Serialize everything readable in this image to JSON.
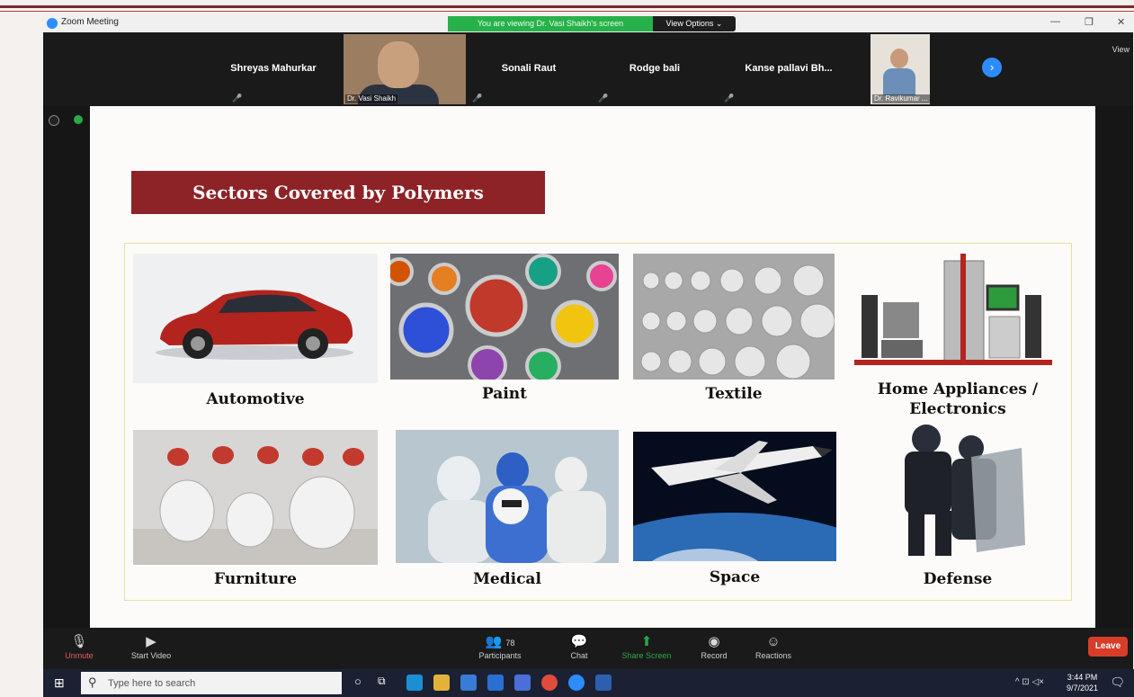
{
  "window": {
    "title": "Zoom Meeting"
  },
  "banner": {
    "viewing_text": "You are viewing Dr. Vasi Shaikh's screen",
    "view_options": "View Options ⌄"
  },
  "gallery": {
    "view_label": "View",
    "participants": [
      {
        "name": "Shreyas Mahurkar"
      },
      {
        "name": "Dr. Vasi Shaikh",
        "video": true
      },
      {
        "name": "Sonali Raut"
      },
      {
        "name": "Rodge bali"
      },
      {
        "name": "Kanse pallavi Bh..."
      },
      {
        "name": "Dr. Ravikumar ...",
        "video": true
      }
    ]
  },
  "slide": {
    "title": "Sectors Covered by Polymers",
    "sectors": [
      {
        "label": "Automotive",
        "icon": "car-image"
      },
      {
        "label": "Paint",
        "icon": "paint-cans-image"
      },
      {
        "label": "Textile",
        "icon": "fabric-rolls-image"
      },
      {
        "label": "Home Appliances / Electronics",
        "icon": "appliances-image"
      },
      {
        "label": "Furniture",
        "icon": "chairs-image"
      },
      {
        "label": "Medical",
        "icon": "medical-staff-image"
      },
      {
        "label": "Space",
        "icon": "space-shuttle-image"
      },
      {
        "label": "Defense",
        "icon": "riot-police-image"
      }
    ]
  },
  "toolbar": {
    "unmute": "Unmute",
    "start_video": "Start Video",
    "participants": "Participants",
    "participants_count": "78",
    "chat": "Chat",
    "share_screen": "Share Screen",
    "record": "Record",
    "reactions": "Reactions",
    "leave": "Leave"
  },
  "taskbar": {
    "search_placeholder": "Type here to search",
    "time": "3:44 PM",
    "date": "9/7/2021"
  },
  "colors": {
    "slide_title_bg": "#8d2326",
    "share_banner": "#27b14a",
    "leave": "#d83d2a",
    "zoom_blue": "#2d8cff"
  }
}
